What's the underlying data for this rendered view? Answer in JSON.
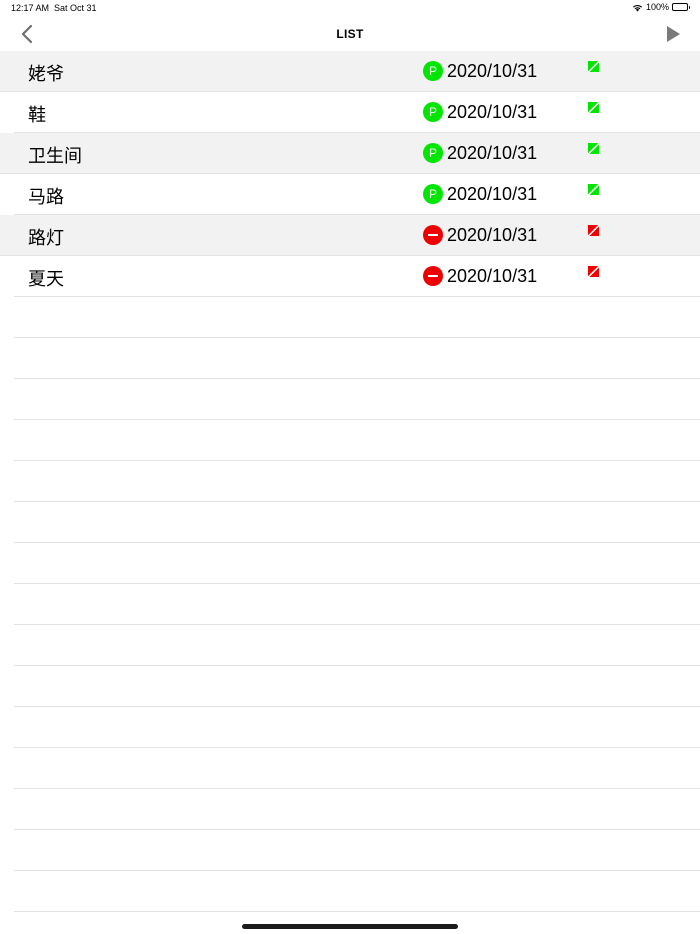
{
  "status_bar": {
    "time": "12:17 AM",
    "date": "Sat Oct 31",
    "battery": "100%",
    "wifi_icon": "wifi-icon",
    "battery_icon": "battery-icon",
    "battery_level": 1.0
  },
  "nav": {
    "title": "LIST",
    "back_icon": "chevron-left-icon",
    "play_icon": "play-icon"
  },
  "colors": {
    "green": "#00e600",
    "red": "#ee0000",
    "shaded_row": "#f2f2f2",
    "separator": "#e2e2e2"
  },
  "rows": [
    {
      "name": "姥爷",
      "status": "P",
      "status_type": "green",
      "date": "2020/10/31",
      "flag": "green",
      "shaded": true
    },
    {
      "name": "鞋",
      "status": "P",
      "status_type": "green",
      "date": "2020/10/31",
      "flag": "green",
      "shaded": false
    },
    {
      "name": "卫生间",
      "status": "P",
      "status_type": "green",
      "date": "2020/10/31",
      "flag": "green",
      "shaded": true
    },
    {
      "name": "马路",
      "status": "P",
      "status_type": "green",
      "date": "2020/10/31",
      "flag": "green",
      "shaded": false
    },
    {
      "name": "路灯",
      "status": "",
      "status_type": "red",
      "date": "2020/10/31",
      "flag": "red",
      "shaded": true
    },
    {
      "name": "夏天",
      "status": "",
      "status_type": "red",
      "date": "2020/10/31",
      "flag": "red",
      "shaded": false
    }
  ],
  "empty_row_count": 15
}
